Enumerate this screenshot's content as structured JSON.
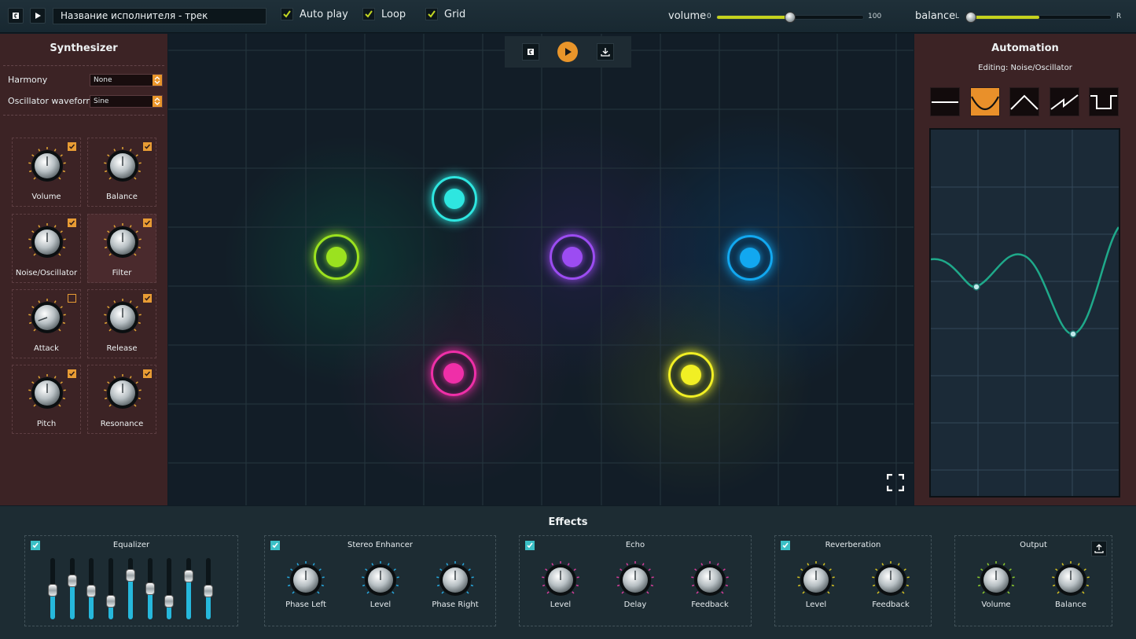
{
  "topbar": {
    "track_title": "Название исполнителя - трек",
    "checks": [
      {
        "label": "Auto play",
        "checked": true
      },
      {
        "label": "Loop",
        "checked": true
      },
      {
        "label": "Grid",
        "checked": true
      }
    ],
    "volume": {
      "label": "volume",
      "min_label": "0",
      "max_label": "100",
      "value": 50
    },
    "balance": {
      "label": "balance",
      "left_label": "L",
      "right_label": "R",
      "value": 0.47
    }
  },
  "synth": {
    "title": "Synthesizer",
    "harmony_label": "Harmony",
    "harmony_value": "None",
    "waveform_label": "Oscillator waveform",
    "waveform_value": "Sine",
    "knobs": [
      {
        "label": "Volume",
        "checked": true
      },
      {
        "label": "Balance",
        "checked": true
      },
      {
        "label": "Noise/Oscillator",
        "checked": true
      },
      {
        "label": "Filter",
        "checked": true,
        "selected": true
      },
      {
        "label": "Attack",
        "checked": false
      },
      {
        "label": "Release",
        "checked": true
      },
      {
        "label": "Pitch",
        "checked": true
      },
      {
        "label": "Resonance",
        "checked": true
      }
    ]
  },
  "nodes": [
    {
      "name": "green",
      "color": "#9be21f"
    },
    {
      "name": "cyan",
      "color": "#2ee6e0"
    },
    {
      "name": "purple",
      "color": "#9c4cf2"
    },
    {
      "name": "blue",
      "color": "#12a8f0"
    },
    {
      "name": "pink",
      "color": "#ef2fa8"
    },
    {
      "name": "yellow",
      "color": "#f1ef24"
    }
  ],
  "automation": {
    "title": "Automation",
    "editing": "Editing: Noise/Oscillator",
    "shapes": [
      "flat",
      "curve",
      "triangle",
      "sawtooth",
      "square"
    ],
    "selected_shape": "curve"
  },
  "effects": {
    "title": "Effects",
    "equalizer": {
      "title": "Equalizer",
      "bands": [
        0.46,
        0.66,
        0.45,
        0.25,
        0.78,
        0.5,
        0.25,
        0.76,
        0.45
      ]
    },
    "stereo": {
      "title": "Stereo Enhancer",
      "knobs": [
        "Phase Left",
        "Level",
        "Phase Right"
      ]
    },
    "echo": {
      "title": "Echo",
      "knobs": [
        "Level",
        "Delay",
        "Feedback"
      ]
    },
    "reverb": {
      "title": "Reverberation",
      "knobs": [
        "Level",
        "Feedback"
      ]
    },
    "output": {
      "title": "Output",
      "knobs": [
        "Volume",
        "Balance"
      ]
    }
  },
  "colors": {
    "accent": "#e9952a",
    "eq": "#26b8dc",
    "stereo": "#27a9e0",
    "echo": "#d83d9c",
    "reverb": "#d7c321",
    "output_left": "#8fcd2c"
  }
}
